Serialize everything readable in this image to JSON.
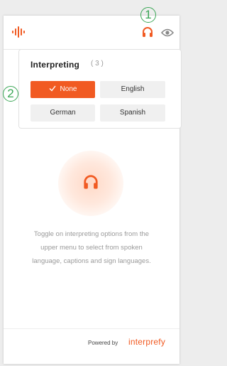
{
  "annotations": {
    "one": "1",
    "two": "2"
  },
  "interpreting": {
    "title": "Interpreting",
    "count": "( 3 )",
    "options": [
      {
        "label": "None",
        "selected": true
      },
      {
        "label": "English",
        "selected": false
      },
      {
        "label": "German",
        "selected": false
      },
      {
        "label": "Spanish",
        "selected": false
      }
    ]
  },
  "empty_state": {
    "line1": "Toggle on interpreting options from the",
    "line2": "upper menu to select from spoken",
    "line3": "language, captions and sign languages."
  },
  "footer": {
    "powered_by": "Powered by",
    "brand": "interprefy"
  },
  "icons": {
    "logo": "interprefy-logo-icon",
    "headphones": "headphones-icon",
    "eye": "eye-icon",
    "check": "check-icon"
  },
  "colors": {
    "accent": "#f15a22",
    "callout": "#3aa655"
  }
}
